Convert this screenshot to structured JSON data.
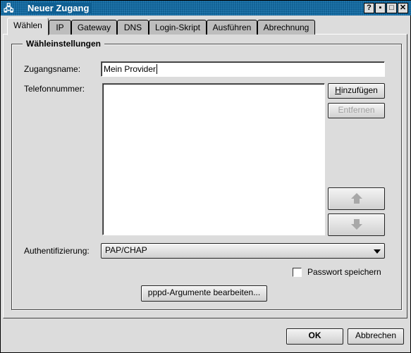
{
  "window": {
    "title": "Neuer Zugang",
    "buttons": [
      "?",
      "▪",
      "□",
      "✕"
    ]
  },
  "tabs": [
    {
      "label": "Wählen",
      "active": true
    },
    {
      "label": "IP"
    },
    {
      "label": "Gateway"
    },
    {
      "label": "DNS"
    },
    {
      "label": "Login-Skript"
    },
    {
      "label": "Ausführen"
    },
    {
      "label": "Abrechnung"
    }
  ],
  "group": {
    "title": "Wähleinstellungen"
  },
  "form": {
    "name_label": "Zugangsname:",
    "name_value": "Mein Provider",
    "phone_label": "Telefonnummer:",
    "phone_numbers": [],
    "add_button": "Hinzufügen",
    "remove_button": "Entfernen",
    "auth_label": "Authentifizierung:",
    "auth_value": "PAP/CHAP",
    "save_password_label": "Passwort speichern",
    "save_password_checked": false,
    "pppd_button": "pppd-Argumente bearbeiten..."
  },
  "footer": {
    "ok": "OK",
    "cancel": "Abbrechen"
  }
}
